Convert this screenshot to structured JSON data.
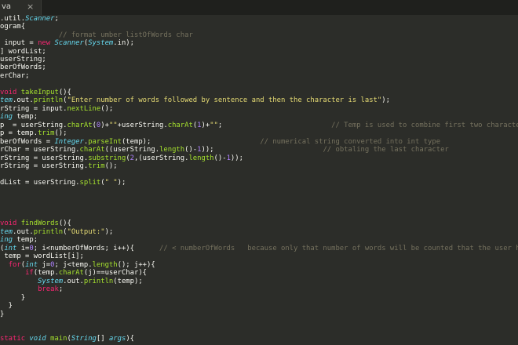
{
  "tab": {
    "label": "va",
    "close_glyph": "×"
  },
  "colors": {
    "background": "#2c2d29",
    "tabbar": "#1f201d",
    "keyword": "#f92672",
    "type": "#66d9ef",
    "function": "#a6e22e",
    "string": "#e6db74",
    "number": "#ae81ff",
    "comment": "#75715e",
    "text": "#f8f8f2"
  },
  "code": [
    [
      [
        "plain",
        ".util."
      ],
      [
        "type",
        "Scanner"
      ],
      [
        "plain",
        ";"
      ]
    ],
    [
      [
        "plain",
        "ogram{"
      ]
    ],
    [
      [
        "plain",
        "              "
      ],
      [
        "com",
        "// format umber listOfWords char"
      ]
    ],
    [
      [
        "plain",
        " input = "
      ],
      [
        "kw",
        "new"
      ],
      [
        "plain",
        " "
      ],
      [
        "type",
        "Scanner"
      ],
      [
        "plain",
        "("
      ],
      [
        "type",
        "System"
      ],
      [
        "plain",
        ".in);"
      ]
    ],
    [
      [
        "plain",
        "] wordList;"
      ]
    ],
    [
      [
        "plain",
        "userString;"
      ]
    ],
    [
      [
        "plain",
        "berOfWords;"
      ]
    ],
    [
      [
        "plain",
        "erChar;"
      ]
    ],
    [],
    [
      [
        "kw",
        "void"
      ],
      [
        "plain",
        " "
      ],
      [
        "func",
        "takeInput"
      ],
      [
        "plain",
        "(){"
      ]
    ],
    [
      [
        "type",
        "tem"
      ],
      [
        "plain",
        ".out."
      ],
      [
        "func",
        "println"
      ],
      [
        "plain",
        "("
      ],
      [
        "str",
        "\"Enter number of words followed by sentence and then the character is last\""
      ],
      [
        "plain",
        ");"
      ]
    ],
    [
      [
        "plain",
        "rString = input."
      ],
      [
        "func",
        "nextLine"
      ],
      [
        "plain",
        "();"
      ]
    ],
    [
      [
        "type",
        "ing"
      ],
      [
        "plain",
        " temp;"
      ]
    ],
    [
      [
        "plain",
        "p  = userString."
      ],
      [
        "func",
        "charAt"
      ],
      [
        "plain",
        "("
      ],
      [
        "num",
        "0"
      ],
      [
        "plain",
        ")+"
      ],
      [
        "str",
        "\"\""
      ],
      [
        "plain",
        "+userString."
      ],
      [
        "func",
        "charAt"
      ],
      [
        "plain",
        "("
      ],
      [
        "num",
        "1"
      ],
      [
        "plain",
        ")+"
      ],
      [
        "str",
        "\"\""
      ],
      [
        "plain",
        ";                          "
      ],
      [
        "com",
        "// Temp is used to combine first two characters fi"
      ]
    ],
    [
      [
        "plain",
        "p = temp."
      ],
      [
        "func",
        "trim"
      ],
      [
        "plain",
        "();"
      ]
    ],
    [
      [
        "plain",
        "berOfWords = "
      ],
      [
        "type",
        "Integer"
      ],
      [
        "plain",
        "."
      ],
      [
        "func",
        "parseInt"
      ],
      [
        "plain",
        "(temp);                          "
      ],
      [
        "com",
        "// numerical string converted into int type"
      ]
    ],
    [
      [
        "plain",
        "rChar = userString."
      ],
      [
        "func",
        "charAt"
      ],
      [
        "plain",
        "((userString."
      ],
      [
        "func",
        "length"
      ],
      [
        "plain",
        "()-"
      ],
      [
        "num",
        "1"
      ],
      [
        "plain",
        "));                          "
      ],
      [
        "com",
        "// obtaling the last character"
      ]
    ],
    [
      [
        "plain",
        "rString = userString."
      ],
      [
        "func",
        "substring"
      ],
      [
        "plain",
        "("
      ],
      [
        "num",
        "2"
      ],
      [
        "plain",
        ",(userString."
      ],
      [
        "func",
        "length"
      ],
      [
        "plain",
        "()-"
      ],
      [
        "num",
        "1"
      ],
      [
        "plain",
        "));"
      ]
    ],
    [
      [
        "plain",
        "rString = userString."
      ],
      [
        "func",
        "trim"
      ],
      [
        "plain",
        "();"
      ]
    ],
    [],
    [
      [
        "plain",
        "dList = userString."
      ],
      [
        "func",
        "split"
      ],
      [
        "plain",
        "("
      ],
      [
        "str",
        "\" \""
      ],
      [
        "plain",
        ");"
      ]
    ],
    [],
    [],
    [],
    [],
    [
      [
        "kw",
        "void"
      ],
      [
        "plain",
        " "
      ],
      [
        "func",
        "findWords"
      ],
      [
        "plain",
        "(){"
      ]
    ],
    [
      [
        "type",
        "tem"
      ],
      [
        "plain",
        ".out."
      ],
      [
        "func",
        "println"
      ],
      [
        "plain",
        "("
      ],
      [
        "str",
        "\"Output:\""
      ],
      [
        "plain",
        ");"
      ]
    ],
    [
      [
        "type",
        "ing"
      ],
      [
        "plain",
        " temp;"
      ]
    ],
    [
      [
        "plain",
        "("
      ],
      [
        "type",
        "int"
      ],
      [
        "plain",
        " i="
      ],
      [
        "num",
        "0"
      ],
      [
        "plain",
        "; i<numberOfWords; i++){      "
      ],
      [
        "com",
        "// < numberOfWords   because only that number of words will be counted that the user has prov"
      ]
    ],
    [
      [
        "plain",
        " temp = wordList[i];"
      ]
    ],
    [
      [
        "plain",
        "  "
      ],
      [
        "kw",
        "for"
      ],
      [
        "plain",
        "("
      ],
      [
        "type",
        "int"
      ],
      [
        "plain",
        " j="
      ],
      [
        "num",
        "0"
      ],
      [
        "plain",
        "; j<temp."
      ],
      [
        "func",
        "length"
      ],
      [
        "plain",
        "(); j++){"
      ]
    ],
    [
      [
        "plain",
        "      "
      ],
      [
        "kw",
        "if"
      ],
      [
        "plain",
        "(temp."
      ],
      [
        "func",
        "charAt"
      ],
      [
        "plain",
        "(j)==userChar){"
      ]
    ],
    [
      [
        "plain",
        "         "
      ],
      [
        "type",
        "System"
      ],
      [
        "plain",
        ".out."
      ],
      [
        "func",
        "println"
      ],
      [
        "plain",
        "(temp);"
      ]
    ],
    [
      [
        "plain",
        "         "
      ],
      [
        "kw",
        "break"
      ],
      [
        "plain",
        ";"
      ]
    ],
    [
      [
        "plain",
        "     }"
      ]
    ],
    [
      [
        "plain",
        "  }"
      ]
    ],
    [
      [
        "plain",
        "}"
      ]
    ],
    [],
    [],
    [
      [
        "kw",
        "static"
      ],
      [
        "plain",
        " "
      ],
      [
        "type",
        "void"
      ],
      [
        "plain",
        " "
      ],
      [
        "func",
        "main"
      ],
      [
        "plain",
        "("
      ],
      [
        "type",
        "String"
      ],
      [
        "plain",
        "[] "
      ],
      [
        "type",
        "args"
      ],
      [
        "plain",
        "){"
      ]
    ]
  ]
}
